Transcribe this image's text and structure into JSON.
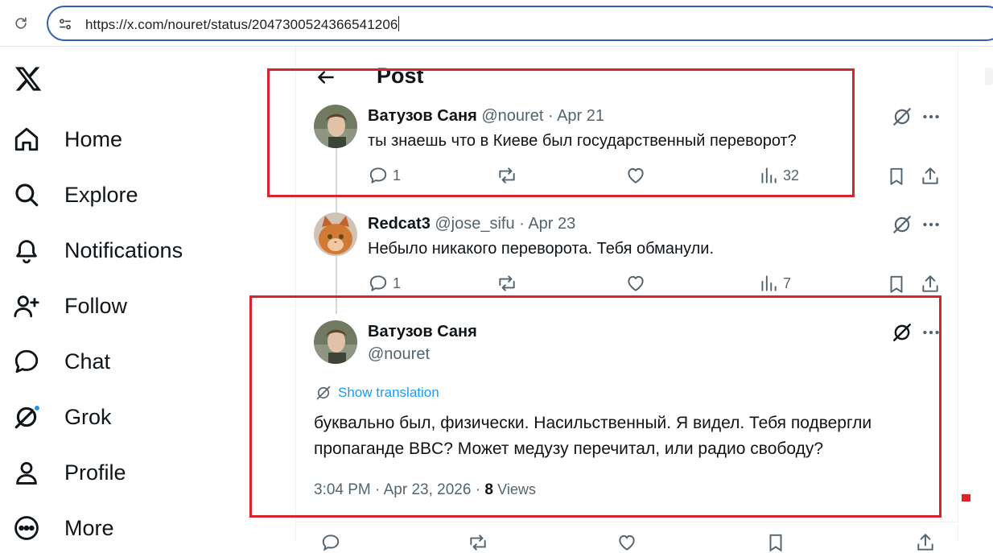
{
  "browser": {
    "url": "https://x.com/nouret/status/2047300524366541206"
  },
  "nav": {
    "items": [
      {
        "label": "Home",
        "icon": "home-icon"
      },
      {
        "label": "Explore",
        "icon": "search-icon"
      },
      {
        "label": "Notifications",
        "icon": "bell-icon"
      },
      {
        "label": "Follow",
        "icon": "add-person-icon"
      },
      {
        "label": "Chat",
        "icon": "chat-bubble-icon"
      },
      {
        "label": "Grok",
        "icon": "grok-icon"
      },
      {
        "label": "Profile",
        "icon": "person-icon"
      },
      {
        "label": "More",
        "icon": "more-circle-icon"
      }
    ]
  },
  "header": {
    "title": "Post"
  },
  "tweets": [
    {
      "name": "Ватузов Саня",
      "handle": "@nouret",
      "separator": "·",
      "date": "Apr 21",
      "text": "ты знаешь что в Киеве был государственный переворот?",
      "replies": "1",
      "views": "32"
    },
    {
      "name": "Redcat3",
      "handle": "@jose_sifu",
      "separator": "·",
      "date": "Apr 23",
      "text": "Небыло никакого переворота. Тебя обманули.",
      "replies": "1",
      "views": "7"
    }
  ],
  "main_tweet": {
    "name": "Ватузов Саня",
    "handle": "@nouret",
    "show_translation": "Show translation",
    "text_line1": "буквально был, физически. Насильственный. Я видел. Тебя подвергли",
    "text_line2": "пропаганде BBC? Может медузу перечитал, или радио свободу?",
    "time": "3:04 PM",
    "separator": "·",
    "date": "Apr 23, 2026",
    "separator2": "·",
    "views_count": "8",
    "views_label": "Views"
  },
  "colors": {
    "accent": "#1d9bf0",
    "annotation": "#d9232d",
    "muted": "#536471"
  }
}
